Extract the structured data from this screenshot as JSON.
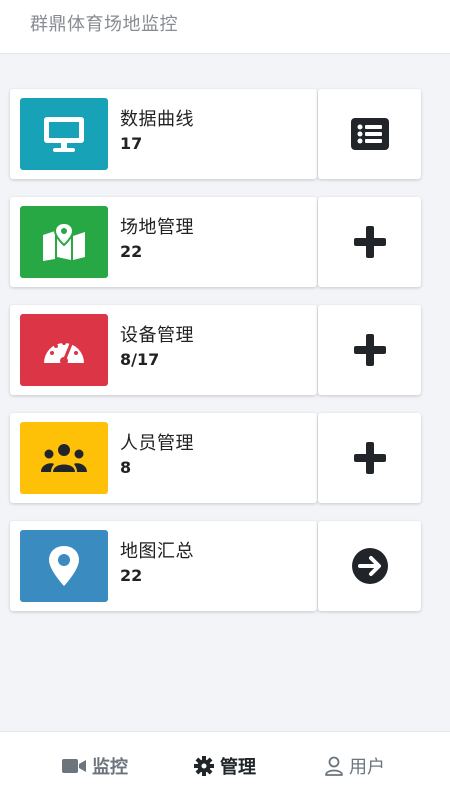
{
  "header": {
    "title": "群鼎体育场地监控"
  },
  "colors": {
    "teal": "#17a2b8",
    "green": "#28a745",
    "red": "#dc3545",
    "yellow": "#ffc107",
    "blue": "#3a8bbf",
    "icon_dark": "#212529"
  },
  "cards": [
    {
      "label": "数据曲线",
      "value": "17",
      "tile_icon": "monitor-icon",
      "action_icon": "list-icon"
    },
    {
      "label": "场地管理",
      "value": "22",
      "tile_icon": "map-icon",
      "action_icon": "plus-icon"
    },
    {
      "label": "设备管理",
      "value": "8/17",
      "tile_icon": "gauge-icon",
      "action_icon": "plus-icon"
    },
    {
      "label": "人员管理",
      "value": "8",
      "tile_icon": "users-icon",
      "action_icon": "plus-icon"
    },
    {
      "label": "地图汇总",
      "value": "22",
      "tile_icon": "map-pin-icon",
      "action_icon": "arrow-right-circle-icon"
    }
  ],
  "nav": [
    {
      "label": "监控",
      "icon": "video-camera-icon",
      "active": false
    },
    {
      "label": "管理",
      "icon": "gear-icon",
      "active": true
    },
    {
      "label": "用户",
      "icon": "user-icon",
      "active": false
    }
  ]
}
